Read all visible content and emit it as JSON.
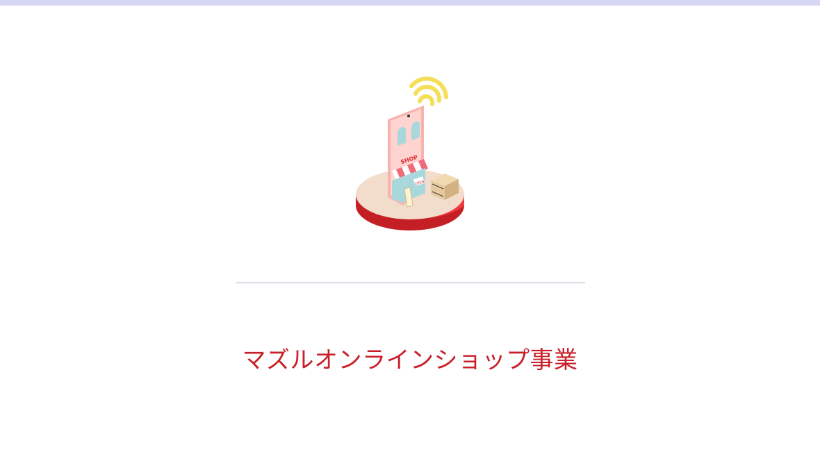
{
  "colors": {
    "top_bar": "#d6d8f3",
    "divider": "#a9a7cc",
    "title": "#c8202a",
    "platform_top": "#f2dccb",
    "platform_side": "#d9292f",
    "phone": "#f7b3ae",
    "window": "#a8d8dc",
    "wifi": "#f5df5a",
    "box": "#e6c9a0"
  },
  "illustration": {
    "icon": "online-shop-icon",
    "shop_sign": "SHOP",
    "open_sign": "OPEN"
  },
  "title": "マズルオンラインショップ事業"
}
